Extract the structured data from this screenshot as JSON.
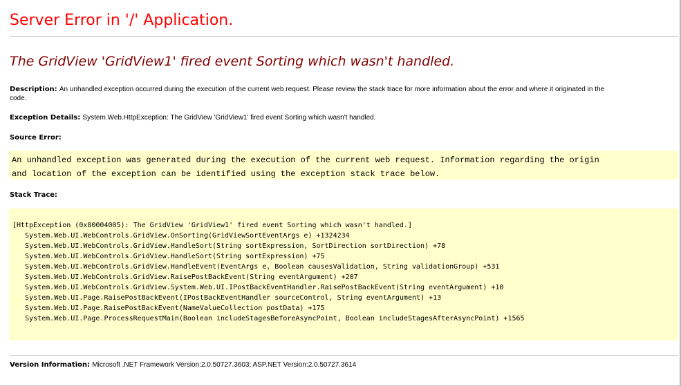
{
  "server_error_title": "Server Error in '/' Application.",
  "error_message": "The GridView 'GridView1' fired event Sorting which wasn't handled.",
  "description": {
    "label": "Description:",
    "text": "An unhandled exception occurred during the execution of the current web request. Please review the stack trace for more information about the error and where it originated in the",
    "text_cont": "code."
  },
  "exception_details": {
    "label": "Exception Details:",
    "text": "System.Web.HttpException: The GridView 'GridView1' fired event Sorting which wasn't handled."
  },
  "source_error": {
    "label": "Source Error:",
    "lines": [
      "An unhandled exception was generated during the execution of the current web request. Information regarding the origin",
      "and location of the exception can be identified using the exception stack trace below."
    ]
  },
  "stack_trace": {
    "label": "Stack Trace:",
    "lines": [
      "[HttpException (0x80004005): The GridView 'GridView1' fired event Sorting which wasn't handled.]",
      "   System.Web.UI.WebControls.GridView.OnSorting(GridViewSortEventArgs e) +1324234",
      "   System.Web.UI.WebControls.GridView.HandleSort(String sortExpression, SortDirection sortDirection) +78",
      "   System.Web.UI.WebControls.GridView.HandleSort(String sortExpression) +75",
      "   System.Web.UI.WebControls.GridView.HandleEvent(EventArgs e, Boolean causesValidation, String validationGroup) +531",
      "   System.Web.UI.WebControls.GridView.RaisePostBackEvent(String eventArgument) +207",
      "   System.Web.UI.WebControls.GridView.System.Web.UI.IPostBackEventHandler.RaisePostBackEvent(String eventArgument) +10",
      "   System.Web.UI.Page.RaisePostBackEvent(IPostBackEventHandler sourceControl, String eventArgument) +13",
      "   System.Web.UI.Page.RaisePostBackEvent(NameValueCollection postData) +175",
      "   System.Web.UI.Page.ProcessRequestMain(Boolean includeStagesBeforeAsyncPoint, Boolean includeStagesAfterAsyncPoint) +1565"
    ]
  },
  "version_information": {
    "label": "Version Information:",
    "text": "Microsoft .NET Framework Version:2.0.50727.3603; ASP.NET Version:2.0.50727.3614"
  },
  "colors": {
    "title": "#ff0000",
    "error_message": "#800000",
    "code_background": "#ffffcc",
    "rule": "#c0c0c0"
  }
}
